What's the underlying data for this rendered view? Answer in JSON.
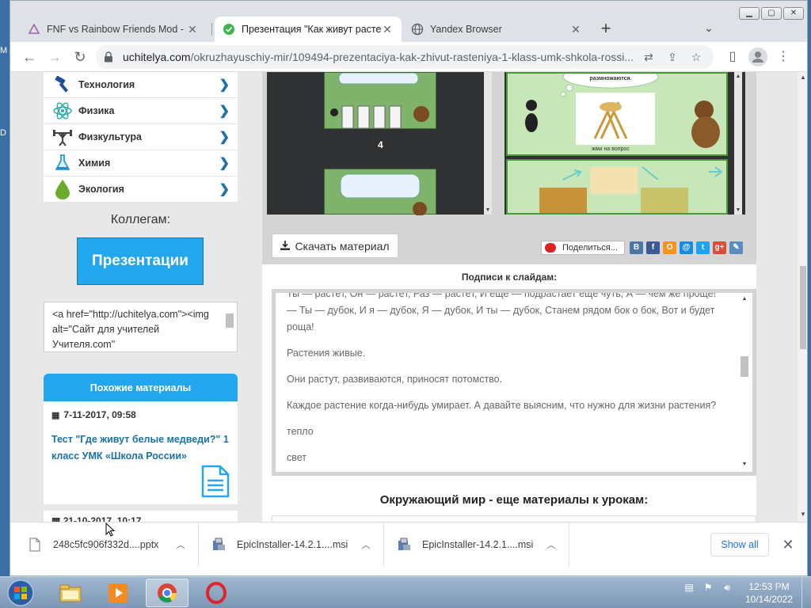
{
  "desktop": {
    "left_chars": [
      "M",
      "D"
    ]
  },
  "tabs": [
    {
      "label": "FNF vs Rainbow Friends Mod - Pl",
      "active": false,
      "icon": "triangle-icon"
    },
    {
      "label": "Презентация \"Как живут растен",
      "active": true,
      "icon": "check-circle-icon"
    },
    {
      "label": "Yandex Browser",
      "active": false,
      "icon": "globe-icon"
    }
  ],
  "address": {
    "domain": "uchitelya.com",
    "path": "/okruzhayuschiy-mir/109494-prezentaciya-kak-zhivut-rasteniya-1-klass-umk-shkola-rossi..."
  },
  "sidebar": {
    "subjects": [
      {
        "label": "Технология",
        "icon": "hammer-icon"
      },
      {
        "label": "Физика",
        "icon": "atom-icon"
      },
      {
        "label": "Физкультура",
        "icon": "weightlifter-icon"
      },
      {
        "label": "Химия",
        "icon": "flask-icon"
      },
      {
        "label": "Экология",
        "icon": "drop-icon"
      }
    ],
    "colleagues_label": "Коллегам:",
    "presentations_button": "Презентации",
    "code_snippet": "<a href=\"http://uchitelya.com\"><img alt=\"Сайт для учителей Учителя.com\"",
    "similar_header": "Похожие материалы",
    "similar_items": [
      {
        "date": "7-11-2017, 09:58",
        "title": "Тест \"Где живут белые медведи?\" 1 класс УМК «Школа России»"
      },
      {
        "date": "21-10-2017, 10:17",
        "title": ""
      }
    ]
  },
  "main": {
    "slide_number": "4",
    "slide_caption_text": "жми на вопрос",
    "slide_top_text": "размножаются.",
    "download_button": "Скачать материал",
    "share_button": "Поделиться...",
    "social_icons": [
      {
        "name": "vk-icon",
        "glyph": "В",
        "color": "#4a76a8"
      },
      {
        "name": "facebook-icon",
        "glyph": "f",
        "color": "#3b5998"
      },
      {
        "name": "odnoklassniki-icon",
        "glyph": "О",
        "color": "#f7931e"
      },
      {
        "name": "mailru-icon",
        "glyph": "@",
        "color": "#168de2"
      },
      {
        "name": "twitter-icon",
        "glyph": "t",
        "color": "#1da1f2"
      },
      {
        "name": "googleplus-icon",
        "glyph": "g+",
        "color": "#dd4b39"
      },
      {
        "name": "livejournal-icon",
        "glyph": "✎",
        "color": "#5a8cbf"
      }
    ],
    "captions_header": "Подписи к слайдам:",
    "captions": [
      "Ты — растёт, Он — растёт, Раз — растёт, И ещё — подрастает ещё чуть, А — чем же проще! — Ты — дубок, И я — дубок, Я — дубок, И ты — дубок, Станем рядом бок о бок, Вот и будет роща!",
      "Растения живые.",
      "Они растут, развиваются, приносят потомство.",
      "Каждое растение когда-нибудь умирает. А давайте выясним, что нужно для жизни растения?",
      "тепло",
      "свет"
    ],
    "more_header": "Окружающий мир - еще материалы к урокам:"
  },
  "downloads": {
    "items": [
      {
        "name": "248c5fc906f332d....pptx",
        "icon": "document-icon"
      },
      {
        "name": "EpicInstaller-14.2.1....msi",
        "icon": "installer-icon"
      },
      {
        "name": "EpicInstaller-14.2.1....msi",
        "icon": "installer-icon"
      }
    ],
    "show_all": "Show all"
  },
  "taskbar": {
    "time": "12:53 PM",
    "date": "10/14/2022"
  },
  "colors": {
    "accent_blue": "#22a7ef",
    "link_blue": "#1a73a8",
    "chrome_frame": "#dee1e6"
  }
}
